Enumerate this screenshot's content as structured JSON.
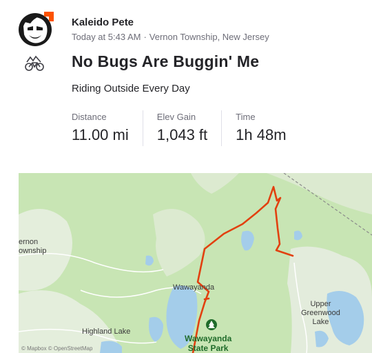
{
  "athlete": {
    "name": "Kaleido Pete"
  },
  "activity": {
    "time": "Today at 5:43 AM",
    "separator": "·",
    "location": "Vernon Township, New Jersey",
    "title": "No Bugs Are Buggin' Me",
    "description": "Riding Outside Every Day"
  },
  "stats": [
    {
      "label": "Distance",
      "value": "11.00 mi"
    },
    {
      "label": "Elev Gain",
      "value": "1,043 ft"
    },
    {
      "label": "Time",
      "value": "1h 48m"
    }
  ],
  "map": {
    "labels": {
      "vernon_line1": "ernon",
      "vernon_line2": "ownship",
      "wawayanda": "Wawayanda",
      "upper_line1": "Upper",
      "upper_line2": "Greenwood",
      "upper_line3": "Lake",
      "highland": "Highland Lake",
      "park_line1": "Wawayanda",
      "park_line2": "State Park"
    },
    "attribution": "© Mapbox © OpenStreetMap",
    "colors": {
      "route": "#e2400f",
      "forest": "#c8e5b4",
      "water": "#a4cdea",
      "park_marker": "#1f6b2a"
    }
  },
  "icons": {
    "sport": "mountain-bike-icon",
    "avatar_badge": "subscriber-badge-icon"
  }
}
